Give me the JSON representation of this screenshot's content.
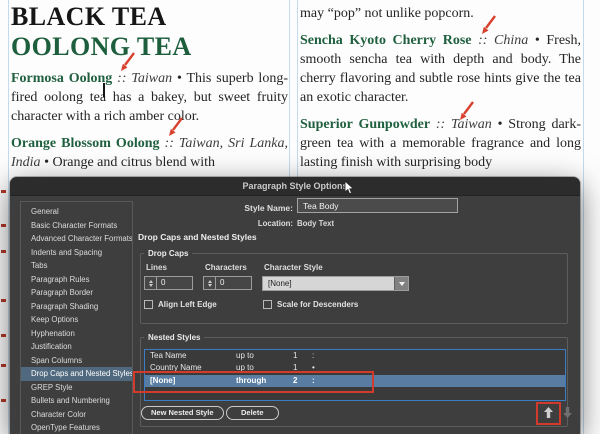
{
  "document": {
    "heading1": "BLACK TEA",
    "heading2": "OOLONG TEA",
    "left_paragraphs": [
      {
        "name": "Formosa Oolong",
        "sep": "::",
        "country": "Taiwan",
        "bullet": "•",
        "body": "This superb long-fired oolong tea has a bakey, but sweet fruity character with a rich amber color."
      },
      {
        "name": "Orange Blossom Oolong",
        "sep": "::",
        "country": "Taiwan, Sri Lanka, India",
        "bullet": "•",
        "body": "Orange and citrus blend with"
      }
    ],
    "right_lead": "may “pop” not unlike popcorn.",
    "right_paragraphs": [
      {
        "name": "Sencha Kyoto Cherry Rose",
        "sep": "::",
        "country": "China",
        "bullet": "•",
        "body": "Fresh, smooth sencha tea with depth and body. The cherry flavoring and subtle rose hints give the tea an exotic character."
      },
      {
        "name": "Superior Gunpowder",
        "sep": "::",
        "country": "Taiwan",
        "bullet": "•",
        "body": "Strong dark-green tea with a memorable fragrance and long lasting finish with surprising body"
      }
    ]
  },
  "dialog": {
    "title": "Paragraph Style Options",
    "sidebar": {
      "items": [
        "General",
        "Basic Character Formats",
        "Advanced Character Formats",
        "Indents and Spacing",
        "Tabs",
        "Paragraph Rules",
        "Paragraph Border",
        "Paragraph Shading",
        "Keep Options",
        "Hyphenation",
        "Justification",
        "Span Columns",
        "Drop Caps and Nested Styles",
        "GREP Style",
        "Bullets and Numbering",
        "Character Color",
        "OpenType Features"
      ],
      "selected": "Drop Caps and Nested Styles"
    },
    "style_name_label": "Style Name:",
    "style_name_value": "Tea Body",
    "location_label": "Location:",
    "location_value": "Body Text",
    "section_heading": "Drop Caps and Nested Styles",
    "drop_caps": {
      "legend": "Drop Caps",
      "lines_label": "Lines",
      "lines_value": "0",
      "characters_label": "Characters",
      "characters_value": "0",
      "character_style_label": "Character Style",
      "character_style_value": "[None]",
      "align_left_edge_label": "Align Left Edge",
      "scale_for_descenders_label": "Scale for Descenders"
    },
    "nested_styles": {
      "legend": "Nested Styles",
      "rows": [
        {
          "style": "Tea Name",
          "mode": "up to",
          "count": "1",
          "delimiter": ":"
        },
        {
          "style": "Country Name",
          "mode": "up to",
          "count": "1",
          "delimiter": "•"
        },
        {
          "style": "[None]",
          "mode": "through",
          "count": "2",
          "delimiter": ":"
        }
      ],
      "selected_index": 2,
      "new_button": "New Nested Style",
      "delete_button": "Delete"
    }
  },
  "colors": {
    "dialog_bg": "#3e3e3e",
    "titlebar_bg": "#2c2c2c",
    "sidebar_selection_blue": "#50697e",
    "table_selection_blue": "#587ca2",
    "table_border_blue": "#3a7dc5",
    "annotation_red": "#d23b2c",
    "column_guide_blue": "#c3dbee",
    "heading_green": "#1d5e3d",
    "tea_name_green": "#20603f"
  }
}
